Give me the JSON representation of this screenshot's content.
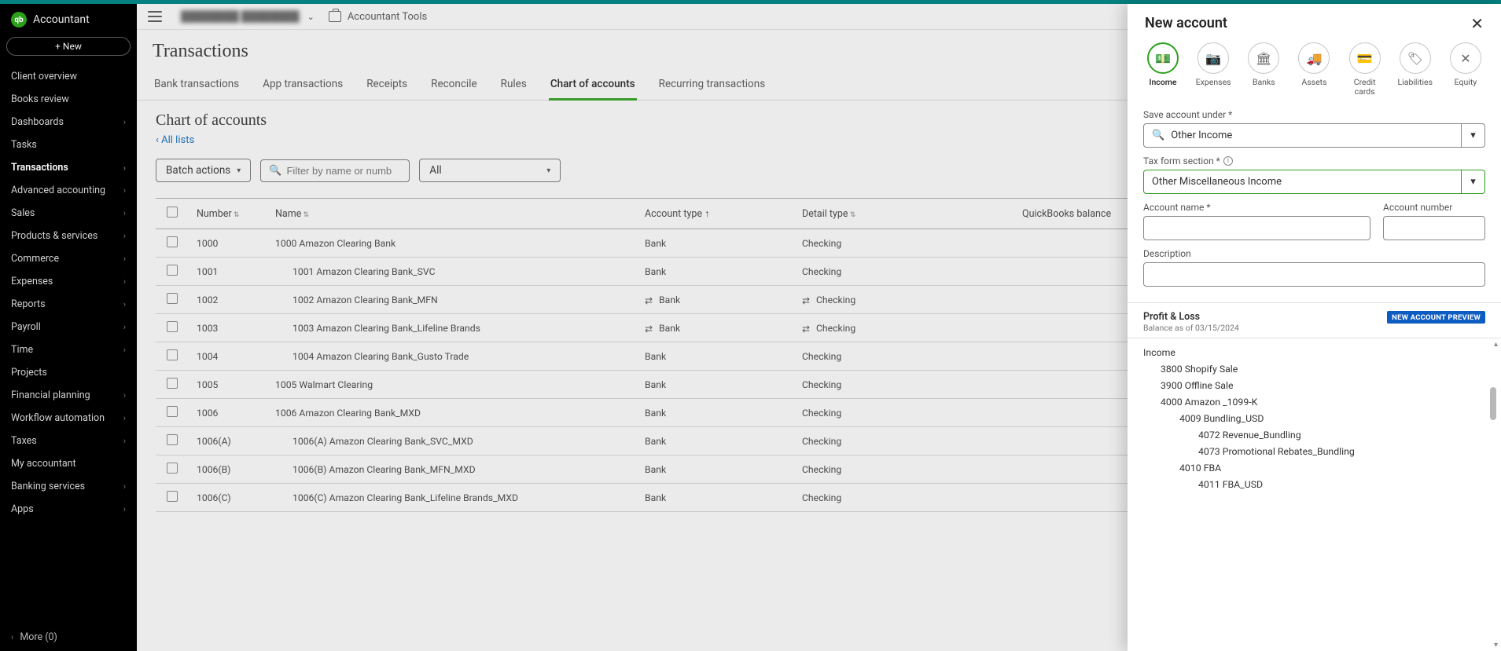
{
  "brand": {
    "short": "qb",
    "name": "Accountant"
  },
  "new_button": "+  New",
  "sidebar": {
    "items": [
      {
        "label": "Client overview",
        "has_children": false
      },
      {
        "label": "Books review",
        "has_children": false
      },
      {
        "label": "Dashboards",
        "has_children": true
      },
      {
        "label": "Tasks",
        "has_children": false
      },
      {
        "label": "Transactions",
        "has_children": true,
        "active": true
      },
      {
        "label": "Advanced accounting",
        "has_children": true
      },
      {
        "label": "Sales",
        "has_children": true
      },
      {
        "label": "Products & services",
        "has_children": true
      },
      {
        "label": "Commerce",
        "has_children": true
      },
      {
        "label": "Expenses",
        "has_children": true
      },
      {
        "label": "Reports",
        "has_children": true
      },
      {
        "label": "Payroll",
        "has_children": true
      },
      {
        "label": "Time",
        "has_children": true
      },
      {
        "label": "Projects",
        "has_children": false
      },
      {
        "label": "Financial planning",
        "has_children": true
      },
      {
        "label": "Workflow automation",
        "has_children": true
      },
      {
        "label": "Taxes",
        "has_children": true
      },
      {
        "label": "My accountant",
        "has_children": false
      },
      {
        "label": "Banking services",
        "has_children": true
      },
      {
        "label": "Apps",
        "has_children": true
      }
    ],
    "more": "More (0)"
  },
  "topbar": {
    "client_name": "████████ ████████",
    "accountant_tools": "Accountant Tools"
  },
  "page": {
    "title": "Transactions",
    "tabs": [
      "Bank transactions",
      "App transactions",
      "Receipts",
      "Reconcile",
      "Rules",
      "Chart of accounts",
      "Recurring transactions"
    ],
    "active_tab_index": 5
  },
  "section": {
    "title": "Chart of accounts",
    "back_link": "‹  All lists",
    "batch_actions": "Batch actions",
    "filter_placeholder": "Filter by name or numb",
    "type_filter": "All"
  },
  "table": {
    "columns": [
      "",
      "Number",
      "Name",
      "Account type",
      "Detail type",
      "QuickBooks balance"
    ],
    "rows": [
      {
        "number": "1000",
        "indent": 0,
        "name": "1000 Amazon Clearing Bank",
        "type": "Bank",
        "type_icon": false,
        "detail": "Checking",
        "detail_icon": false
      },
      {
        "number": "1001",
        "indent": 1,
        "name": "1001 Amazon Clearing Bank_SVC",
        "type": "Bank",
        "type_icon": false,
        "detail": "Checking",
        "detail_icon": false
      },
      {
        "number": "1002",
        "indent": 1,
        "name": "1002 Amazon Clearing Bank_MFN",
        "type": "Bank",
        "type_icon": true,
        "detail": "Checking",
        "detail_icon": true
      },
      {
        "number": "1003",
        "indent": 1,
        "name": "1003 Amazon Clearing Bank_Lifeline Brands",
        "type": "Bank",
        "type_icon": true,
        "detail": "Checking",
        "detail_icon": true
      },
      {
        "number": "1004",
        "indent": 1,
        "name": "1004 Amazon Clearing Bank_Gusto Trade",
        "type": "Bank",
        "type_icon": false,
        "detail": "Checking",
        "detail_icon": false
      },
      {
        "number": "1005",
        "indent": 0,
        "name": "1005 Walmart Clearing",
        "type": "Bank",
        "type_icon": false,
        "detail": "Checking",
        "detail_icon": false
      },
      {
        "number": "1006",
        "indent": 0,
        "name": "1006 Amazon Clearing Bank_MXD",
        "type": "Bank",
        "type_icon": false,
        "detail": "Checking",
        "detail_icon": false
      },
      {
        "number": "1006(A)",
        "indent": 1,
        "name": "1006(A) Amazon Clearing Bank_SVC_MXD",
        "type": "Bank",
        "type_icon": false,
        "detail": "Checking",
        "detail_icon": false
      },
      {
        "number": "1006(B)",
        "indent": 1,
        "name": "1006(B) Amazon Clearing Bank_MFN_MXD",
        "type": "Bank",
        "type_icon": false,
        "detail": "Checking",
        "detail_icon": false
      },
      {
        "number": "1006(C)",
        "indent": 1,
        "name": "1006(C) Amazon Clearing Bank_Lifeline Brands_MXD",
        "type": "Bank",
        "type_icon": false,
        "detail": "Checking",
        "detail_icon": false
      }
    ]
  },
  "drawer": {
    "title": "New account",
    "types": [
      "Income",
      "Expenses",
      "Banks",
      "Assets",
      "Credit cards",
      "Liabilities",
      "Equity"
    ],
    "active_type_index": 0,
    "labels": {
      "save_under": "Save account under *",
      "tax_form": "Tax form section *",
      "account_name": "Account name *",
      "account_number": "Account number",
      "description": "Description"
    },
    "save_under_value": "Other Income",
    "tax_form_value": "Other Miscellaneous Income",
    "account_name_value": "",
    "account_number_value": "",
    "description_value": "",
    "preview": {
      "title": "Profit & Loss",
      "subtitle": "Balance as of 03/15/2024",
      "badge": "NEW ACCOUNT PREVIEW",
      "lines": [
        {
          "text": "Income",
          "indent": 0
        },
        {
          "text": "3800 Shopify Sale",
          "indent": 1
        },
        {
          "text": "3900 Offline Sale",
          "indent": 1
        },
        {
          "text": "4000 Amazon _1099-K",
          "indent": 1
        },
        {
          "text": "4009 Bundling_USD",
          "indent": 2
        },
        {
          "text": "4072 Revenue_Bundling",
          "indent": 3
        },
        {
          "text": "4073 Promotional Rebates_Bundling",
          "indent": 3
        },
        {
          "text": "4010 FBA",
          "indent": 2
        },
        {
          "text": "4011 FBA_USD",
          "indent": 3
        }
      ]
    }
  }
}
